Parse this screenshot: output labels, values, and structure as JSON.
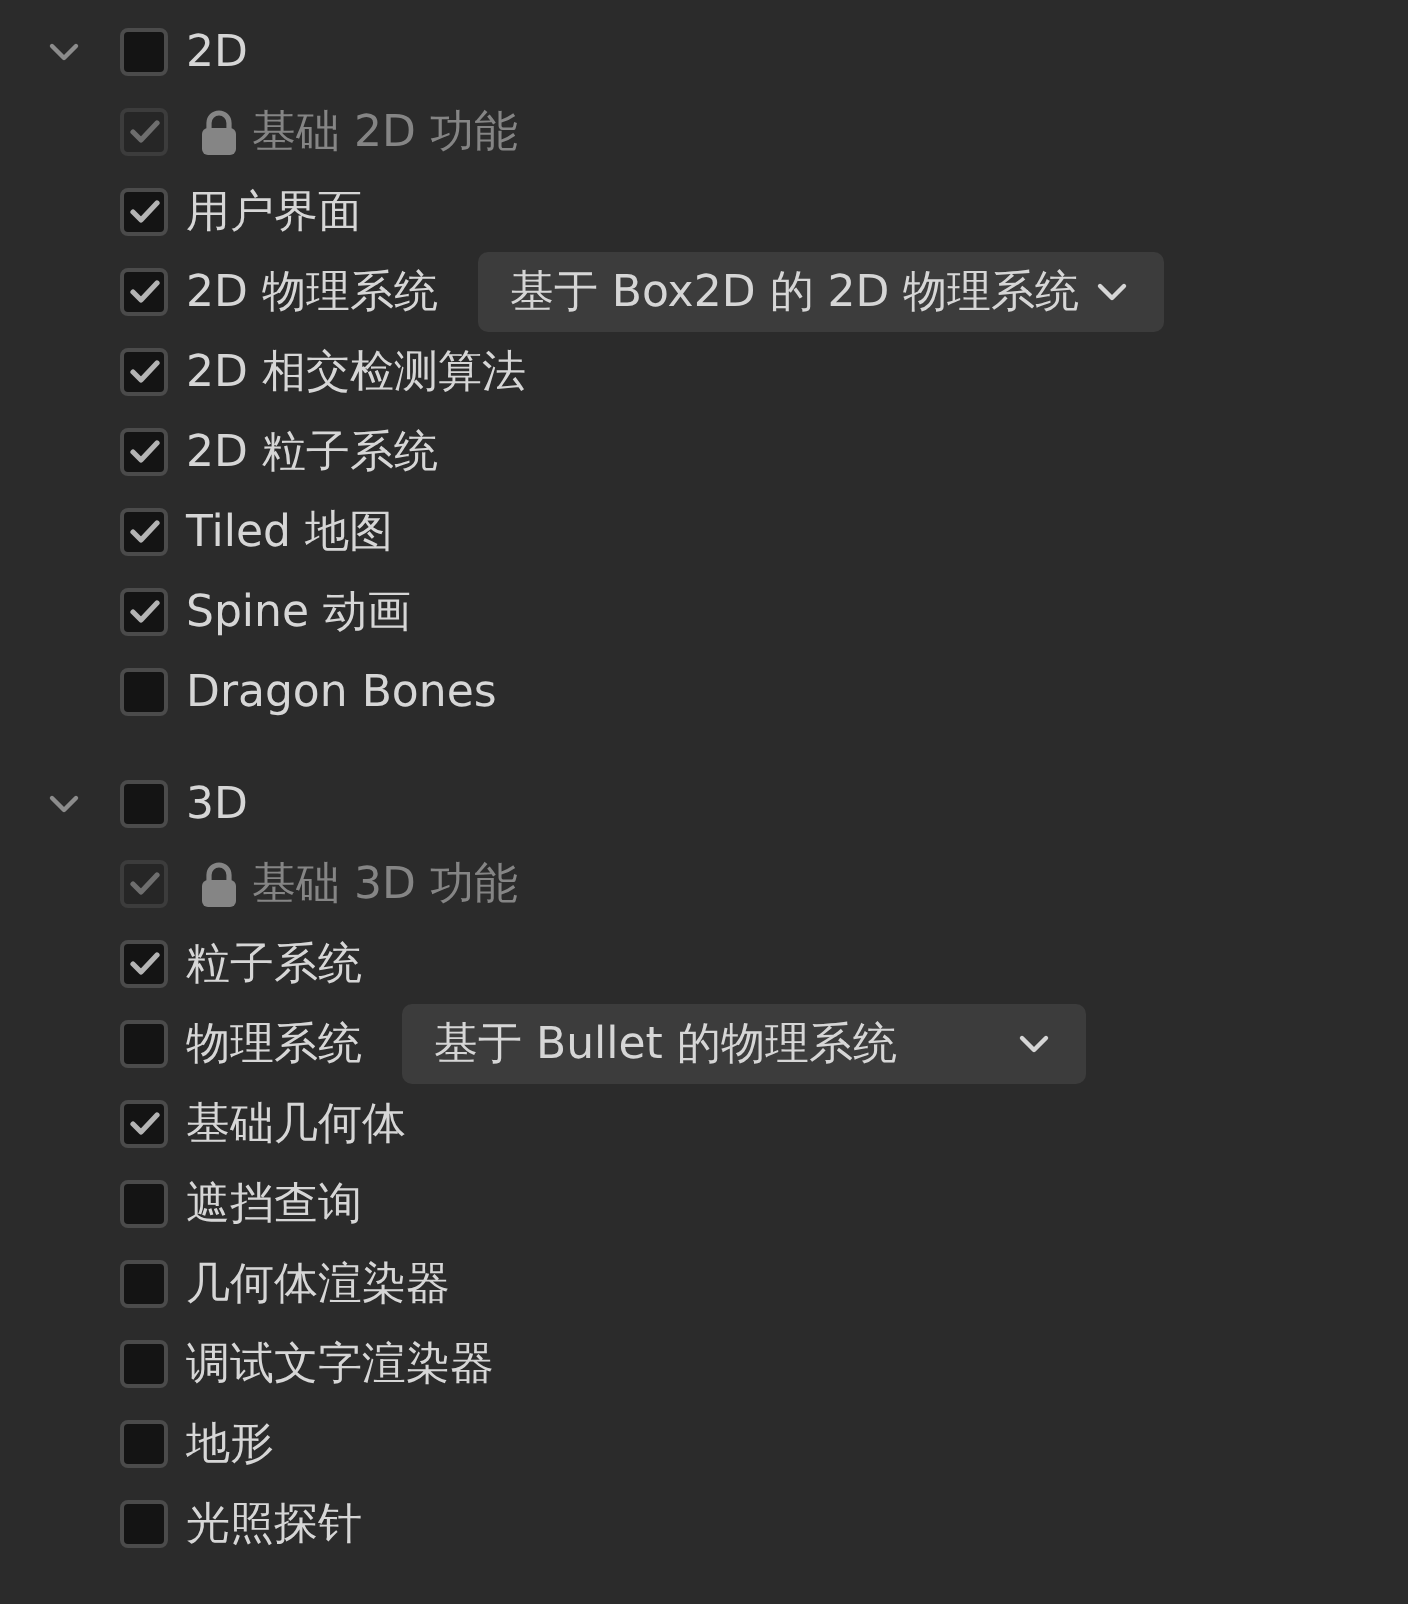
{
  "groups": [
    {
      "label": "2D",
      "expanded": true,
      "checked": false,
      "items": [
        {
          "kind": "locked",
          "label": "基础 2D 功能",
          "checked": true,
          "disabled": true
        },
        {
          "kind": "plain",
          "label": "用户界面",
          "checked": true,
          "disabled": false
        },
        {
          "kind": "select",
          "label": "2D 物理系统",
          "checked": true,
          "disabled": false,
          "select": {
            "value": "基于 Box2D 的 2D 物理系统"
          }
        },
        {
          "kind": "plain",
          "label": "2D 相交检测算法",
          "checked": true,
          "disabled": false
        },
        {
          "kind": "plain",
          "label": "2D 粒子系统",
          "checked": true,
          "disabled": false
        },
        {
          "kind": "plain",
          "label": "Tiled 地图",
          "checked": true,
          "disabled": false
        },
        {
          "kind": "plain",
          "label": "Spine 动画",
          "checked": true,
          "disabled": false
        },
        {
          "kind": "plain",
          "label": "Dragon Bones",
          "checked": false,
          "disabled": false
        }
      ]
    },
    {
      "label": "3D",
      "expanded": true,
      "checked": false,
      "items": [
        {
          "kind": "locked",
          "label": "基础 3D 功能",
          "checked": true,
          "disabled": true
        },
        {
          "kind": "plain",
          "label": "粒子系统",
          "checked": true,
          "disabled": false
        },
        {
          "kind": "select",
          "label": "物理系统",
          "checked": false,
          "disabled": false,
          "select": {
            "value": "基于 Bullet 的物理系统"
          }
        },
        {
          "kind": "plain",
          "label": "基础几何体",
          "checked": true,
          "disabled": false
        },
        {
          "kind": "plain",
          "label": "遮挡查询",
          "checked": false,
          "disabled": false
        },
        {
          "kind": "plain",
          "label": "几何体渲染器",
          "checked": false,
          "disabled": false
        },
        {
          "kind": "plain",
          "label": "调试文字渲染器",
          "checked": false,
          "disabled": false
        },
        {
          "kind": "plain",
          "label": "地形",
          "checked": false,
          "disabled": false
        },
        {
          "kind": "plain",
          "label": "光照探针",
          "checked": false,
          "disabled": false
        }
      ]
    }
  ]
}
